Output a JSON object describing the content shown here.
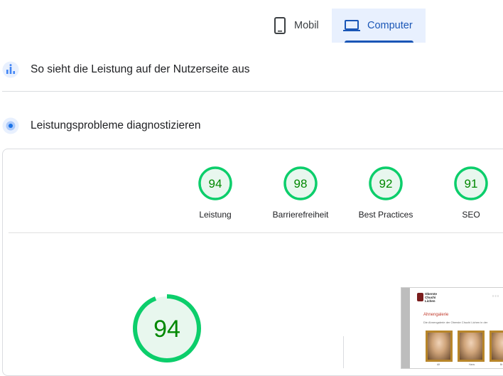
{
  "device_tabs": {
    "mobile_label": "Mobil",
    "desktop_label": "Computer",
    "selected": "desktop",
    "accent_color": "#1a56b6"
  },
  "sections": {
    "field_data_title": "So sieht die Leistung auf der Nutzerseite aus",
    "diagnose_title": "Leistungsprobleme diagnostizieren"
  },
  "scores": [
    {
      "value": "94",
      "label": "Leistung"
    },
    {
      "value": "98",
      "label": "Barrierefreiheit"
    },
    {
      "value": "92",
      "label": "Best Practices"
    },
    {
      "value": "91",
      "label": "SEO"
    }
  ],
  "main_score": {
    "value": "94"
  },
  "colors": {
    "pass_ring": "#0cce6b",
    "pass_fill": "#e8f7ee",
    "pass_text": "#008800"
  },
  "icons": {
    "mobile": "smartphone-icon",
    "desktop": "laptop-icon",
    "field_data": "people-chart-icon",
    "diagnose": "lab-target-icon"
  },
  "screenshot": {
    "logo_text_1": "Oberste",
    "logo_text_2": "Chuchi",
    "logo_text_3": "Lichen",
    "heading": "Ahnengalerie",
    "intro": "Die Ahnengalerie der Oberste Chuchi Lichen in der",
    "names": [
      "Alf",
      "Hans",
      "Br"
    ]
  }
}
